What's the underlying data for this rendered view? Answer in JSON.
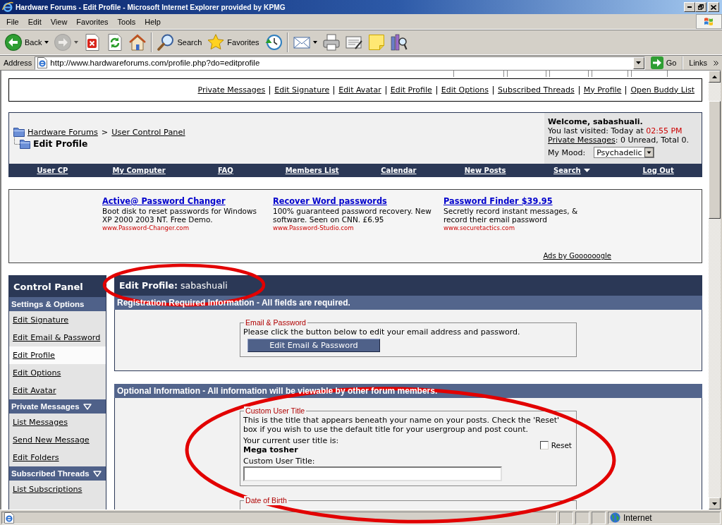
{
  "window": {
    "title": "Hardware Forums - Edit Profile - Microsoft Internet Explorer provided by KPMG"
  },
  "menu": [
    {
      "label": "File"
    },
    {
      "label": "Edit"
    },
    {
      "label": "View"
    },
    {
      "label": "Favorites"
    },
    {
      "label": "Tools"
    },
    {
      "label": "Help"
    }
  ],
  "toolbar": {
    "groups": [
      {
        "buttons": [
          {
            "kind": "back",
            "label": "Back",
            "menu": true,
            "disabled": false
          },
          {
            "kind": "forward",
            "menu": true,
            "disabled": true
          },
          {
            "kind": "stop",
            "menu": false,
            "disabled": false
          },
          {
            "kind": "refresh",
            "menu": false,
            "disabled": false
          },
          {
            "kind": "home",
            "menu": false,
            "disabled": false
          }
        ]
      },
      {
        "buttons": [
          {
            "kind": "search",
            "label": "Search",
            "menu": false,
            "disabled": false
          },
          {
            "kind": "favorites",
            "label": "Favorites",
            "menu": false,
            "disabled": false
          },
          {
            "kind": "history",
            "menu": false,
            "disabled": false
          }
        ]
      },
      {
        "buttons": [
          {
            "kind": "mail",
            "menu": true,
            "disabled": false
          },
          {
            "kind": "print",
            "menu": false,
            "disabled": false
          },
          {
            "kind": "edit",
            "menu": false,
            "disabled": false
          },
          {
            "kind": "discuss",
            "menu": false,
            "disabled": false
          },
          {
            "kind": "research",
            "menu": false,
            "disabled": false
          }
        ]
      }
    ]
  },
  "address_bar": {
    "label": "Address",
    "url": "http://www.hardwareforums.com/profile.php?do=editprofile",
    "go": "Go",
    "links": "Links"
  },
  "page": {
    "user_links": [
      "Private Messages",
      "Edit Signature",
      "Edit Avatar",
      "Edit Profile",
      "Edit Options",
      "Subscribed Threads",
      "My Profile",
      "Open Buddy List"
    ],
    "breadcrumb": {
      "links": [
        "Hardware Forums",
        "User Control Panel"
      ],
      "separator": ">",
      "current": "Edit Profile"
    },
    "welcome": {
      "greeting": "Welcome, sabashuali.",
      "last_visit": "You last visited: Today at",
      "last_visit_time": "02:55 PM",
      "messages_link": "Private Messages",
      "messages_counts": ": 0 Unread, Total 0.",
      "mood_label": "My Mood:",
      "mood": "Psychadelic"
    },
    "navbar": [
      {
        "label": "User CP",
        "dropdown": false
      },
      {
        "label": "My Computer",
        "dropdown": false
      },
      {
        "label": "FAQ",
        "dropdown": false
      },
      {
        "label": "Members List",
        "dropdown": false
      },
      {
        "label": "Calendar",
        "dropdown": false
      },
      {
        "label": "New Posts",
        "dropdown": false
      },
      {
        "label": "Search",
        "dropdown": true
      },
      {
        "label": "Log Out",
        "dropdown": false
      }
    ],
    "ads": [
      {
        "title": "Active@ Password Changer",
        "description": "Boot disk to reset passwords for Windows XP 2000 2003 NT. Free Demo.",
        "url": "www.Password-Changer.com"
      },
      {
        "title": "Recover Word passwords",
        "description": "100% guaranteed password recovery. New software. Seen on CNN. £6.95",
        "url": "www.Password-Studio.com"
      },
      {
        "title": "Password Finder $39.95",
        "description": "Secretly record instant messages, & record their email password",
        "url": "www.securetactics.com"
      }
    ],
    "ads_credit": "Ads by Goooooogle",
    "sidebar": {
      "title": "Control Panel",
      "sections": [
        {
          "title": "Settings & Options",
          "collapsible": false,
          "items": [
            {
              "label": "Edit Signature",
              "selected": false
            },
            {
              "label": "Edit Email & Password",
              "selected": false
            },
            {
              "label": "Edit Profile",
              "selected": true
            },
            {
              "label": "Edit Options",
              "selected": false
            },
            {
              "label": "Edit Avatar",
              "selected": false
            }
          ]
        },
        {
          "title": "Private Messages",
          "collapsible": true,
          "items": [
            {
              "label": "List Messages",
              "selected": false
            },
            {
              "label": "Send New Message",
              "selected": false
            },
            {
              "label": "Edit Folders",
              "selected": false
            }
          ]
        },
        {
          "title": "Subscribed Threads",
          "collapsible": true,
          "items": [
            {
              "label": "List Subscriptions",
              "selected": false
            }
          ]
        }
      ]
    },
    "content": {
      "heading": "**Edit Profile:** sabashuali",
      "panels": [
        {
          "header": "Registration Required Information - All fields are required.",
          "fieldsets": [
            {
              "kind": "button",
              "legend": "Email & Password",
              "description": "Please click the button below to edit your email address and password.",
              "button": "Edit Email & Password"
            }
          ]
        },
        {
          "header": "Optional Information - All information will be viewable by other forum members.",
          "fieldsets": [
            {
              "kind": "user_title",
              "legend": "Custom User Title",
              "description": "This is the title that appears beneath your name on your posts. Check the 'Reset' box if you wish to use the default title for your usergroup and post count.",
              "current_label": "Your current user title is:",
              "current_title": "Mega tosher",
              "reset": {
                "label": "Reset",
                "checked": false
              },
              "field_label": "Custom User Title:"
            },
            {
              "kind": "legend_only",
              "legend": "Date of Birth"
            }
          ]
        }
      ]
    }
  },
  "status_bar": {
    "zone": "Internet"
  }
}
